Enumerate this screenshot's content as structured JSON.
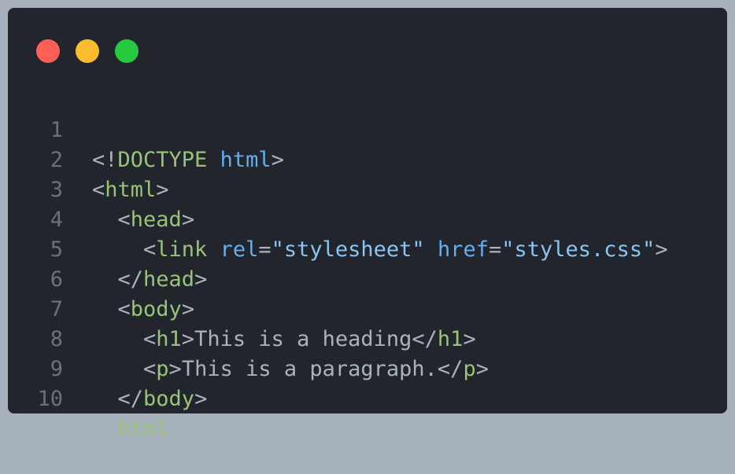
{
  "window": {
    "controls": {
      "close_color": "#ff5f56",
      "minimize_color": "#ffbd2e",
      "maximize_color": "#27c93f"
    }
  },
  "code": {
    "line_numbers": [
      "1",
      "2",
      "3",
      "4",
      "5",
      "6",
      "7",
      "8",
      "9",
      "10"
    ],
    "lines": [
      [
        "<!",
        "DOCTYPE",
        " ",
        "html",
        ">"
      ],
      [
        "<",
        "html",
        ">"
      ],
      [
        "  <",
        "head",
        ">"
      ],
      [
        "    <",
        "link",
        " ",
        "rel",
        "=",
        "\"stylesheet\"",
        " ",
        "href",
        "=",
        "\"styles.css\"",
        ">"
      ],
      [
        "  </",
        "head",
        ">"
      ],
      [
        "  <",
        "body",
        ">"
      ],
      [
        "    <",
        "h1",
        ">",
        "This is a heading",
        "</",
        "h1",
        ">"
      ],
      [
        "    <",
        "p",
        ">",
        "This is a paragraph.",
        "</",
        "p",
        ">"
      ],
      [
        "  </",
        "body",
        ">"
      ],
      [
        "</",
        "html",
        ">"
      ]
    ]
  }
}
